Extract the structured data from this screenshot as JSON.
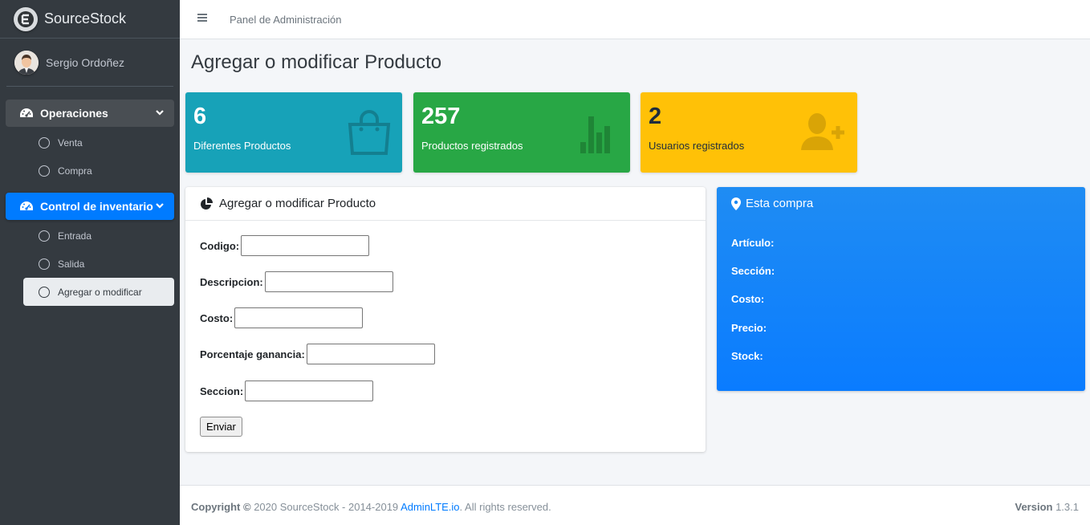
{
  "brand": {
    "name": "SourceStock"
  },
  "user": {
    "name": "Sergio Ordoñez"
  },
  "sidebar": {
    "groups": [
      {
        "label": "Operaciones",
        "items": [
          {
            "label": "Venta"
          },
          {
            "label": "Compra"
          }
        ]
      },
      {
        "label": "Control de inventario",
        "items": [
          {
            "label": "Entrada"
          },
          {
            "label": "Salida"
          },
          {
            "label": "Agregar o modificar"
          }
        ]
      }
    ]
  },
  "topbar": {
    "link": "Panel de Administración"
  },
  "page": {
    "title": "Agregar o modificar Producto"
  },
  "infoboxes": [
    {
      "value": "6",
      "label": "Diferentes Productos",
      "icon": "shopping-bag-icon",
      "color": "#17a2b8"
    },
    {
      "value": "257",
      "label": "Productos registrados",
      "icon": "bar-chart-icon",
      "color": "#28a745"
    },
    {
      "value": "2",
      "label": "Usuarios registrados",
      "icon": "user-plus-icon",
      "color": "#ffc107"
    }
  ],
  "form": {
    "title": "Agregar o modificar Producto",
    "fields": [
      {
        "label": "Codigo:",
        "value": ""
      },
      {
        "label": "Descripcion:",
        "value": ""
      },
      {
        "label": "Costo:",
        "value": ""
      },
      {
        "label": "Porcentaje ganancia:",
        "value": ""
      },
      {
        "label": "Seccion:",
        "value": ""
      }
    ],
    "submit_label": "Enviar"
  },
  "purchase": {
    "title": "Esta compra",
    "fields": [
      "Artículo:",
      "Sección:",
      "Costo:",
      "Precio:",
      "Stock:"
    ]
  },
  "footer": {
    "copyright_label": "Copyright ©",
    "copyright_text": "2020 SourceStock - 2014-2019",
    "link": "AdminLTE.io",
    "rights": ". All rights reserved.",
    "version_label": "Version",
    "version": "1.3.1"
  }
}
